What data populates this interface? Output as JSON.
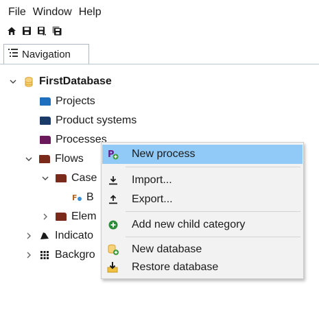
{
  "menu": [
    "File",
    "Window",
    "Help"
  ],
  "toolbar": [
    {
      "icon": "home-icon"
    },
    {
      "icon": "save-icon"
    },
    {
      "icon": "save-as-icon"
    },
    {
      "icon": "save-all-icon"
    }
  ],
  "tab": {
    "label": "Navigation",
    "icon": "navigation-icon"
  },
  "tree": {
    "database": "FirstDatabase",
    "projects": "Projects",
    "product_systems": "Product systems",
    "processes": "Processes",
    "flows": "Flows",
    "case": "Case",
    "case_child": "B",
    "elem": "Elem",
    "indicators": "Indicato",
    "background": "Backgro"
  },
  "context_menu": {
    "new_process": "New process",
    "import": "Import...",
    "export": "Export...",
    "add_child_category": "Add new child category",
    "new_database": "New database",
    "restore_database": "Restore database"
  },
  "colors": {
    "highlight": "#91c9f7",
    "folder_blue": "#1f6fbf",
    "folder_dark_blue": "#1a3a6a",
    "folder_purple": "#6a1a5c",
    "folder_brown": "#7a2a1a",
    "database_yellow": "#e8b93a"
  }
}
